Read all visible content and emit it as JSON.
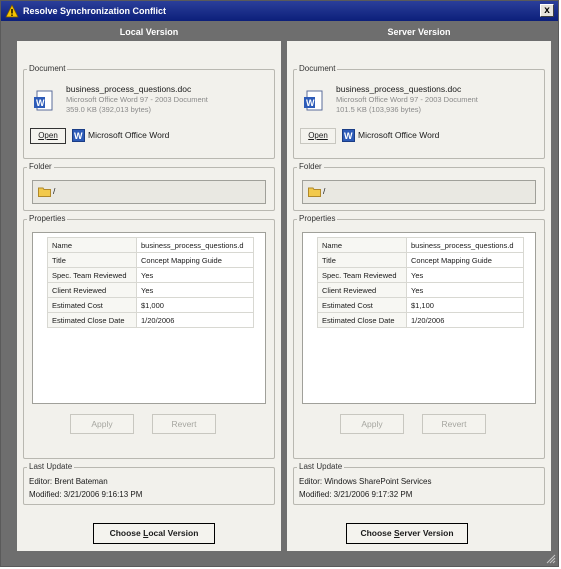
{
  "window": {
    "title": "Resolve Synchronization Conflict",
    "close_label": "x"
  },
  "local": {
    "header": "Local Version",
    "document_label": "Document",
    "file_name": "business_process_questions.doc",
    "file_type": "Microsoft Office Word 97 - 2003 Document",
    "file_size": "359.0 KB (392,013 bytes)",
    "open_label": "Open",
    "app_label": "Microsoft Office Word",
    "folder_label": "Folder",
    "folder_path": "/",
    "properties_label": "Properties",
    "properties": [
      {
        "key": "Name",
        "value": "business_process_questions.d"
      },
      {
        "key": "Title",
        "value": "Concept Mapping Guide"
      },
      {
        "key": "Spec. Team Reviewed",
        "value": "Yes"
      },
      {
        "key": "Client Reviewed",
        "value": "Yes"
      },
      {
        "key": "Estimated Cost",
        "value": "$1,000"
      },
      {
        "key": "Estimated Close Date",
        "value": "1/20/2006"
      }
    ],
    "apply_label": "Apply",
    "revert_label": "Revert",
    "last_update_label": "Last Update",
    "editor": "Editor: Brent Bateman",
    "modified": "Modified: 3/21/2006 9:16:13 PM",
    "choose_prefix": "Choose ",
    "choose_key": "L",
    "choose_rest": "ocal Version"
  },
  "server": {
    "header": "Server Version",
    "document_label": "Document",
    "file_name": "business_process_questions.doc",
    "file_type": "Microsoft Office Word 97 - 2003 Document",
    "file_size": "101.5 KB (103,936 bytes)",
    "open_label": "Open",
    "app_label": "Microsoft Office Word",
    "folder_label": "Folder",
    "folder_path": "/",
    "properties_label": "Properties",
    "properties": [
      {
        "key": "Name",
        "value": "business_process_questions.d"
      },
      {
        "key": "Title",
        "value": "Concept Mapping Guide"
      },
      {
        "key": "Spec. Team Reviewed",
        "value": "Yes"
      },
      {
        "key": "Client Reviewed",
        "value": "Yes"
      },
      {
        "key": "Estimated Cost",
        "value": "$1,100"
      },
      {
        "key": "Estimated Close Date",
        "value": "1/20/2006"
      }
    ],
    "apply_label": "Apply",
    "revert_label": "Revert",
    "last_update_label": "Last Update",
    "editor": "Editor: Windows SharePoint Services",
    "modified": "Modified: 3/21/2006 9:17:32 PM",
    "choose_prefix": "Choose ",
    "choose_key": "S",
    "choose_rest": "erver Version"
  }
}
